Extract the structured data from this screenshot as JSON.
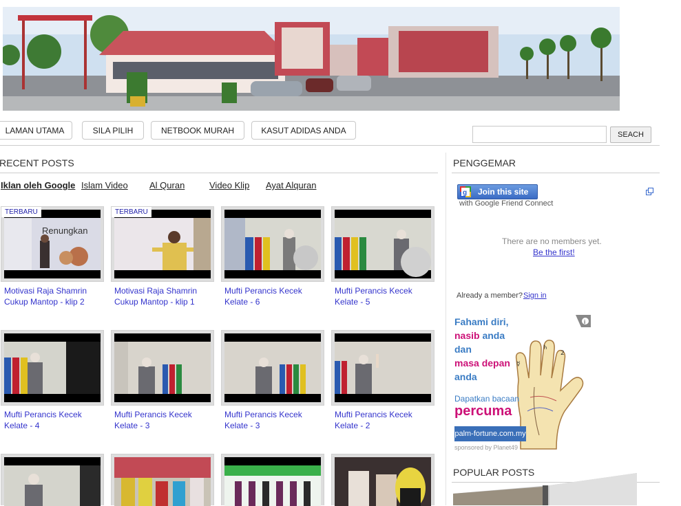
{
  "nav": {
    "items": [
      {
        "label": "LAMAN UTAMA"
      },
      {
        "label": "SILA PILIH"
      },
      {
        "label": "NETBOOK MURAH"
      },
      {
        "label": "KASUT ADIDAS ANDA"
      }
    ]
  },
  "search": {
    "button_label": "SEACH",
    "value": ""
  },
  "recent": {
    "title": "RECENT POSTS",
    "tabs": [
      "Iklan oleh Google",
      "Islam Video",
      "Al Quran",
      "Video Klip",
      "Ayat Alquran"
    ],
    "badge": "TERBARU",
    "posts": [
      {
        "caption": "Motivasi Raja Shamrin Cukup Mantop - klip 2"
      },
      {
        "caption": "Motivasi Raja Shamrin Cukup Mantop - klip 1"
      },
      {
        "caption": "Mufti Perancis Kecek Kelate - 6"
      },
      {
        "caption": "Mufti Perancis Kecek Kelate - 5"
      },
      {
        "caption": "Mufti Perancis Kecek Kelate - 4"
      },
      {
        "caption": "Mufti Perancis Kecek Kelate - 3"
      },
      {
        "caption": "Mufti Perancis Kecek Kelate - 3"
      },
      {
        "caption": "Mufti Perancis Kecek Kelate - 2"
      }
    ]
  },
  "sidebar": {
    "fans_title": "PENGGEMAR",
    "join_label": "Join this site",
    "gfc_text": "with Google Friend Connect",
    "no_members": "There are no members yet.",
    "be_first": "Be the first!",
    "already_member": "Already a member?",
    "sign_in": "Sign in",
    "popular_title": "POPULAR POSTS"
  },
  "ad": {
    "line1": "Fahami diri,",
    "line2a": "nasib",
    "line2b": " anda",
    "line3": "dan",
    "line4": "masa depan",
    "line5": "anda",
    "line6": "Dapatkan bacaan",
    "line7": "percuma",
    "url": "palm-fortune.com.my",
    "sponsor": "sponsored by Planet49"
  },
  "colors": {
    "link": "#3333cc",
    "ad_blue": "#3a7cc4",
    "ad_magenta": "#cc1177"
  }
}
